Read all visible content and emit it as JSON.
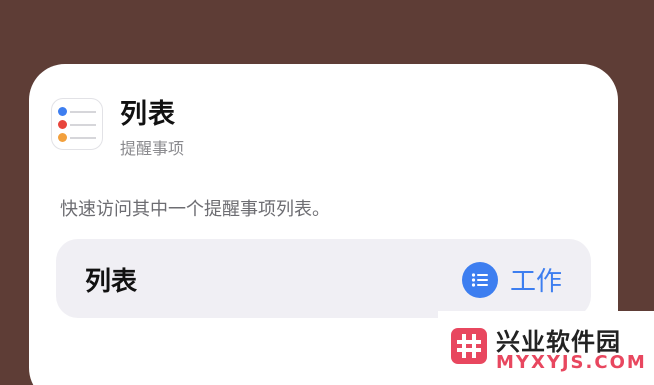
{
  "app": {
    "title": "列表",
    "subtitle": "提醒事项",
    "icon": "reminders-app-icon",
    "dot_colors": [
      "#3d7ef0",
      "#e8453c",
      "#f2a03d"
    ]
  },
  "description": "快速访问其中一个提醒事项列表。",
  "list_row": {
    "label": "列表",
    "value": "工作",
    "value_icon": "list-bullet-icon",
    "accent_color": "#3d7ef0"
  },
  "watermark": {
    "name": "兴业软件园",
    "url": "MYXYJS.COM",
    "logo_icon": "hash-logo-icon",
    "brand_color": "#e8475f"
  }
}
